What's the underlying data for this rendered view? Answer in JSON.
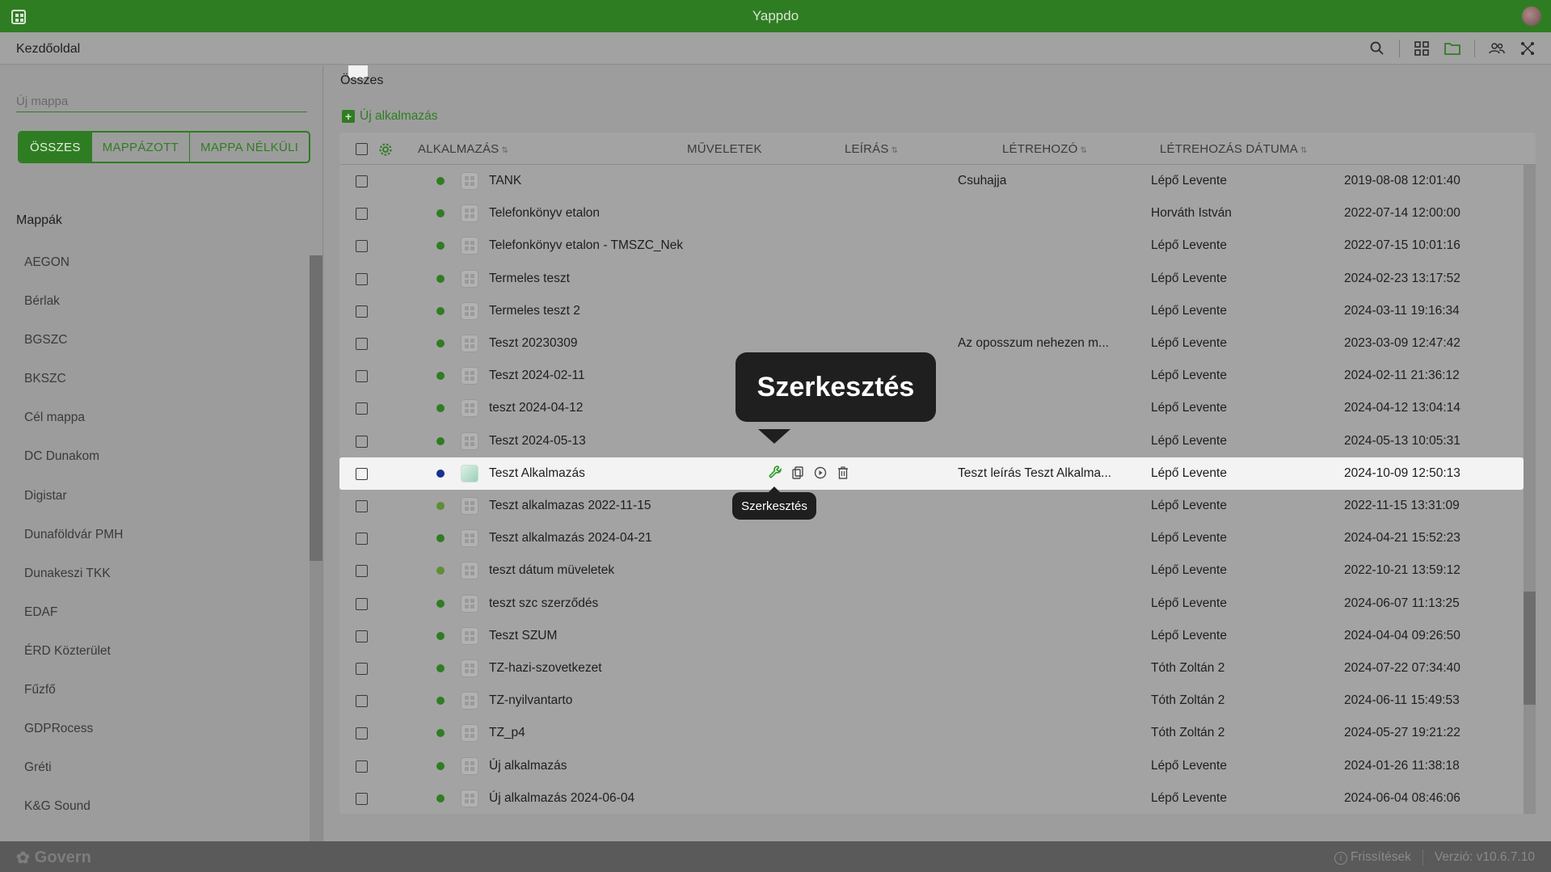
{
  "titlebar": {
    "title": "Yappdo"
  },
  "header": {
    "home_label": "Kezdőoldal",
    "icons": [
      "search-icon",
      "grid-view-icon",
      "folder-icon",
      "users-icon",
      "network-icon"
    ]
  },
  "sidebar": {
    "new_folder_placeholder": "Új mappa",
    "filters": [
      "ÖSSZES",
      "MAPPÁZOTT",
      "MAPPA NÉLKÜLI"
    ],
    "folders_title": "Mappák",
    "folders": [
      "AEGON",
      "Bérlak",
      "BGSZC",
      "BKSZC",
      "Cél mappa",
      "DC Dunakom",
      "Digistar",
      "Dunaföldvár PMH",
      "Dunakeszi TKK",
      "EDAF",
      "ÉRD Közterület",
      "Fűzfő",
      "GDPRocess",
      "Gréti",
      "K&G Sound"
    ]
  },
  "main": {
    "tab_label": "Összes",
    "new_app_label": "Új alkalmazás",
    "columns": {
      "app": "ALKALMAZÁS",
      "actions": "MŰVELETEK",
      "description": "LEÍRÁS",
      "creator": "LÉTREHOZÓ",
      "created": "LÉTREHOZÁS DÁTUMA"
    },
    "rows": [
      {
        "name": "TANK",
        "desc": "Csuhajja",
        "creator": "Lépő Levente",
        "date": "2019-08-08 12:01:40",
        "status": "green"
      },
      {
        "name": "Telefonkönyv etalon",
        "desc": "",
        "creator": "Horváth István",
        "date": "2022-07-14 12:00:00",
        "status": "green"
      },
      {
        "name": "Telefonkönyv etalon - TMSZC_Nek",
        "desc": "",
        "creator": "Lépő Levente",
        "date": "2022-07-15 10:01:16",
        "status": "green"
      },
      {
        "name": "Termeles teszt",
        "desc": "",
        "creator": "Lépő Levente",
        "date": "2024-02-23 13:17:52",
        "status": "green"
      },
      {
        "name": "Termeles teszt 2",
        "desc": "",
        "creator": "Lépő Levente",
        "date": "2024-03-11 19:16:34",
        "status": "green"
      },
      {
        "name": "Teszt 20230309",
        "desc": "Az oposszum nehezen m...",
        "creator": "Lépő Levente",
        "date": "2023-03-09 12:47:42",
        "status": "green"
      },
      {
        "name": "Teszt 2024-02-11",
        "desc": "",
        "creator": "Lépő Levente",
        "date": "2024-02-11 21:36:12",
        "status": "green"
      },
      {
        "name": "teszt 2024-04-12",
        "desc": "",
        "creator": "Lépő Levente",
        "date": "2024-04-12 13:04:14",
        "status": "green"
      },
      {
        "name": "Teszt 2024-05-13",
        "desc": "",
        "creator": "Lépő Levente",
        "date": "2024-05-13 10:05:31",
        "status": "green"
      },
      {
        "name": "Teszt Alkalmazás",
        "desc": "Teszt leírás Teszt Alkalma...",
        "creator": "Lépő Levente",
        "date": "2024-10-09 12:50:13",
        "status": "blue",
        "selected": true
      },
      {
        "name": "Teszt alkalmazas 2022-11-15",
        "desc": "",
        "creator": "Lépő Levente",
        "date": "2022-11-15 13:31:09",
        "status": "light"
      },
      {
        "name": "Teszt alkalmazás 2024-04-21",
        "desc": "",
        "creator": "Lépő Levente",
        "date": "2024-04-21 15:52:23",
        "status": "green"
      },
      {
        "name": "teszt dátum müveletek",
        "desc": "",
        "creator": "Lépő Levente",
        "date": "2022-10-21 13:59:12",
        "status": "light"
      },
      {
        "name": "teszt szc szerződés",
        "desc": "",
        "creator": "Lépő Levente",
        "date": "2024-06-07 11:13:25",
        "status": "green"
      },
      {
        "name": "Teszt SZUM",
        "desc": "",
        "creator": "Lépő Levente",
        "date": "2024-04-04 09:26:50",
        "status": "green"
      },
      {
        "name": "TZ-hazi-szovetkezet",
        "desc": "",
        "creator": "Tóth Zoltán 2",
        "date": "2024-07-22 07:34:40",
        "status": "green"
      },
      {
        "name": "TZ-nyilvantarto",
        "desc": "",
        "creator": "Tóth Zoltán 2",
        "date": "2024-06-11 15:49:53",
        "status": "green"
      },
      {
        "name": "TZ_p4",
        "desc": "",
        "creator": "Tóth Zoltán 2",
        "date": "2024-05-27 19:21:22",
        "status": "green"
      },
      {
        "name": "Új alkalmazás",
        "desc": "",
        "creator": "Lépő Levente",
        "date": "2024-01-26 11:38:18",
        "status": "green"
      },
      {
        "name": "Új alkalmazás 2024-06-04",
        "desc": "",
        "creator": "Lépő Levente",
        "date": "2024-06-04 08:46:06",
        "status": "green"
      }
    ],
    "row_actions": [
      "wrench-icon",
      "copy-icon",
      "play-icon",
      "trash-icon"
    ]
  },
  "tooltip": {
    "large": "Szerkesztés",
    "small": "Szerkesztés"
  },
  "footer": {
    "brand": "Govern",
    "updates": "Frissítések",
    "version": "Verzió: v10.6.7.10"
  },
  "colors": {
    "primary": "#2f7d22",
    "status_green": "#2f7d22",
    "status_light": "#5e8e38",
    "status_blue": "#1a2f8f"
  }
}
